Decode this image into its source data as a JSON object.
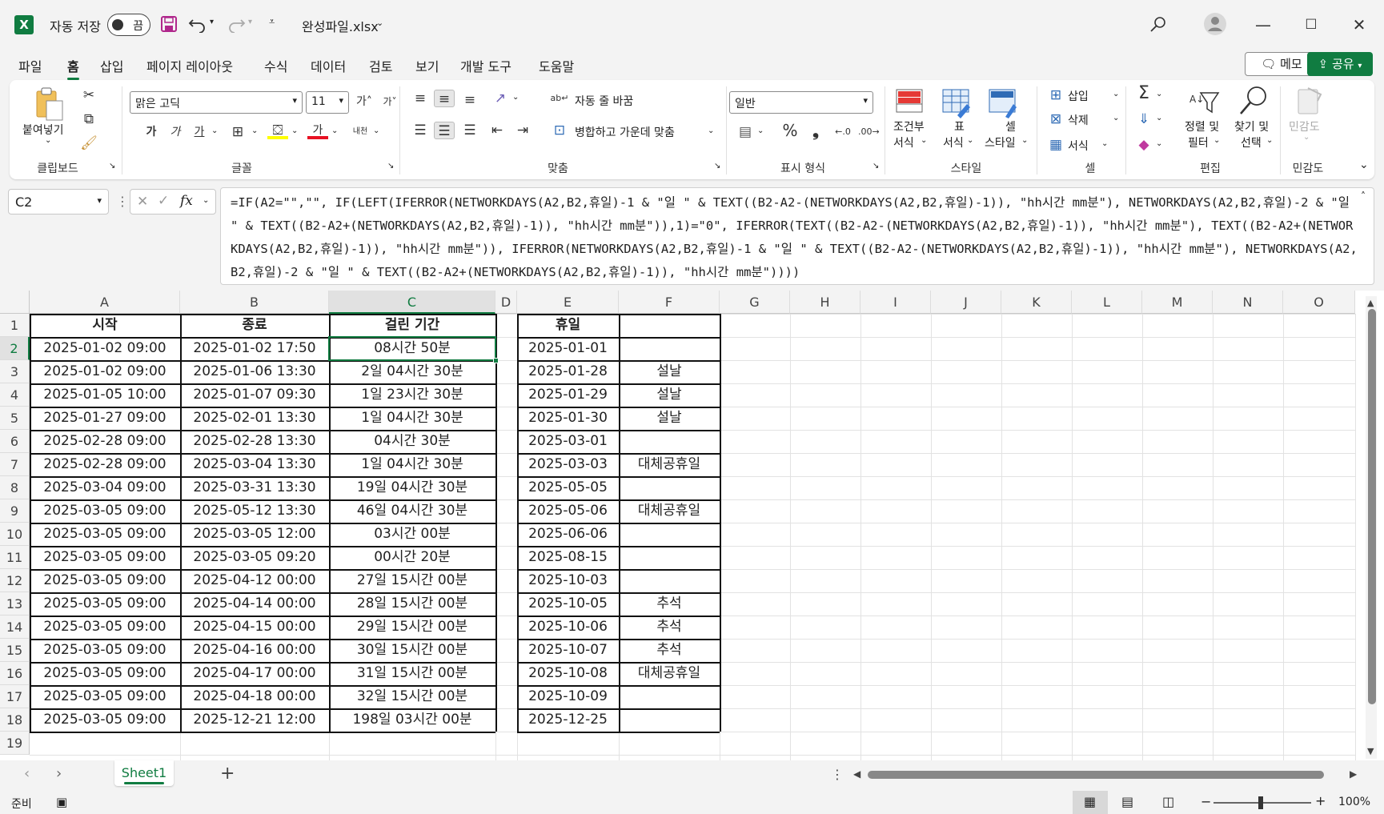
{
  "titlebar": {
    "logo": "X",
    "autosave_label": "자동 저장",
    "autosave_state": "끔",
    "filename": "완성파일.xlsx",
    "icons": [
      "save-icon",
      "undo-icon",
      "redo-icon",
      "customize-icon",
      "search-icon",
      "account-icon",
      "minimize-icon",
      "maximize-icon",
      "close-icon"
    ]
  },
  "menu": {
    "items": [
      "파일",
      "홈",
      "삽입",
      "페이지 레이아웃",
      "수식",
      "데이터",
      "검토",
      "보기",
      "개발 도구",
      "도움말"
    ],
    "active": "홈",
    "memo": "메모",
    "share": "공유"
  },
  "ribbon": {
    "clipboard": {
      "paste": "붙여넣기",
      "label": "클립보드"
    },
    "font": {
      "name": "맑은 고딕",
      "size": "11",
      "bold": "가",
      "italic": "가",
      "underline": "가",
      "label": "글꼴",
      "font_color": "#e81123",
      "fill_color": "#ffff00"
    },
    "alignment": {
      "wrap": "자동 줄 바꿈",
      "merge": "병합하고 가운데 맞춤",
      "label": "맞춤"
    },
    "number": {
      "format": "일반",
      "label": "표시 형식"
    },
    "styles": {
      "conditional": "조건부 서식",
      "table": "표 서식",
      "cell": "셀 스타일",
      "cond_line1": "조건부",
      "cond_line2": "서식",
      "table_line1": "표",
      "table_line2": "서식",
      "cell_line1": "셀",
      "cell_line2": "스타일",
      "label": "스타일"
    },
    "cells": {
      "insert": "삽입",
      "delete": "삭제",
      "format": "서식",
      "label": "셀"
    },
    "editing": {
      "sort_line1": "정렬 및",
      "sort_line2": "필터",
      "find_line1": "찾기 및",
      "find_line2": "선택",
      "label": "편집"
    },
    "sensitivity": {
      "btn": "민감도",
      "label": "민감도"
    }
  },
  "formula_bar": {
    "name_box": "C2",
    "fx": "fx",
    "formula": "=IF(A2=\"\",\"\", IF(LEFT(IFERROR(NETWORKDAYS(A2,B2,휴일)-1 & \"일 \" & TEXT((B2-A2-(NETWORKDAYS(A2,B2,휴일)-1)), \"hh시간 mm분\"), NETWORKDAYS(A2,B2,휴일)-2 & \"일 \" & TEXT((B2-A2+(NETWORKDAYS(A2,B2,휴일)-1)), \"hh시간 mm분\")),1)=\"0\", IFERROR(TEXT((B2-A2-(NETWORKDAYS(A2,B2,휴일)-1)), \"hh시간 mm분\"), TEXT((B2-A2+(NETWORKDAYS(A2,B2,휴일)-1)), \"hh시간 mm분\")), IFERROR(NETWORKDAYS(A2,B2,휴일)-1 & \"일 \" & TEXT((B2-A2-(NETWORKDAYS(A2,B2,휴일)-1)), \"hh시간 mm분\"), NETWORKDAYS(A2,B2,휴일)-2 & \"일 \" & TEXT((B2-A2+(NETWORKDAYS(A2,B2,휴일)-1)), \"hh시간 mm분\"))))"
  },
  "sheet": {
    "columns": [
      "A",
      "B",
      "C",
      "D",
      "E",
      "F",
      "G",
      "H",
      "I",
      "J",
      "K",
      "L",
      "M",
      "N",
      "O"
    ],
    "selected_column": "C",
    "selected_row": 2,
    "rows": [
      "1",
      "2",
      "3",
      "4",
      "5",
      "6",
      "7",
      "8",
      "9",
      "10",
      "11",
      "12",
      "13",
      "14",
      "15",
      "16",
      "17",
      "18",
      "19"
    ],
    "headers": {
      "a": "시작",
      "b": "종료",
      "c": "걸린 기간",
      "e": "휴일"
    },
    "data": [
      {
        "a": "2025-01-02 09:00",
        "b": "2025-01-02 17:50",
        "c": "08시간 50분",
        "e": "2025-01-01",
        "f": ""
      },
      {
        "a": "2025-01-02 09:00",
        "b": "2025-01-06 13:30",
        "c": "2일 04시간 30분",
        "e": "2025-01-28",
        "f": "설날"
      },
      {
        "a": "2025-01-05 10:00",
        "b": "2025-01-07 09:30",
        "c": "1일 23시간 30분",
        "e": "2025-01-29",
        "f": "설날"
      },
      {
        "a": "2025-01-27 09:00",
        "b": "2025-02-01 13:30",
        "c": "1일 04시간 30분",
        "e": "2025-01-30",
        "f": "설날"
      },
      {
        "a": "2025-02-28 09:00",
        "b": "2025-02-28 13:30",
        "c": "04시간 30분",
        "e": "2025-03-01",
        "f": ""
      },
      {
        "a": "2025-02-28 09:00",
        "b": "2025-03-04 13:30",
        "c": "1일 04시간 30분",
        "e": "2025-03-03",
        "f": "대체공휴일"
      },
      {
        "a": "2025-03-04 09:00",
        "b": "2025-03-31 13:30",
        "c": "19일 04시간 30분",
        "e": "2025-05-05",
        "f": ""
      },
      {
        "a": "2025-03-05 09:00",
        "b": "2025-05-12 13:30",
        "c": "46일 04시간 30분",
        "e": "2025-05-06",
        "f": "대체공휴일"
      },
      {
        "a": "2025-03-05 09:00",
        "b": "2025-03-05 12:00",
        "c": "03시간 00분",
        "e": "2025-06-06",
        "f": ""
      },
      {
        "a": "2025-03-05 09:00",
        "b": "2025-03-05 09:20",
        "c": "00시간 20분",
        "e": "2025-08-15",
        "f": ""
      },
      {
        "a": "2025-03-05 09:00",
        "b": "2025-04-12 00:00",
        "c": "27일 15시간 00분",
        "e": "2025-10-03",
        "f": ""
      },
      {
        "a": "2025-03-05 09:00",
        "b": "2025-04-14 00:00",
        "c": "28일 15시간 00분",
        "e": "2025-10-05",
        "f": "추석"
      },
      {
        "a": "2025-03-05 09:00",
        "b": "2025-04-15 00:00",
        "c": "29일 15시간 00분",
        "e": "2025-10-06",
        "f": "추석"
      },
      {
        "a": "2025-03-05 09:00",
        "b": "2025-04-16 00:00",
        "c": "30일 15시간 00분",
        "e": "2025-10-07",
        "f": "추석"
      },
      {
        "a": "2025-03-05 09:00",
        "b": "2025-04-17 00:00",
        "c": "31일 15시간 00분",
        "e": "2025-10-08",
        "f": "대체공휴일"
      },
      {
        "a": "2025-03-05 09:00",
        "b": "2025-04-18 00:00",
        "c": "32일 15시간 00분",
        "e": "2025-10-09",
        "f": ""
      },
      {
        "a": "2025-03-05 09:00",
        "b": "2025-12-21 12:00",
        "c": "198일 03시간 00분",
        "e": "2025-12-25",
        "f": ""
      }
    ]
  },
  "tabs": {
    "sheet1": "Sheet1",
    "add": "+"
  },
  "status": {
    "ready": "준비",
    "zoom": "100%"
  },
  "colors": {
    "accent": "#107c41",
    "grid": "#e2e2e2"
  }
}
